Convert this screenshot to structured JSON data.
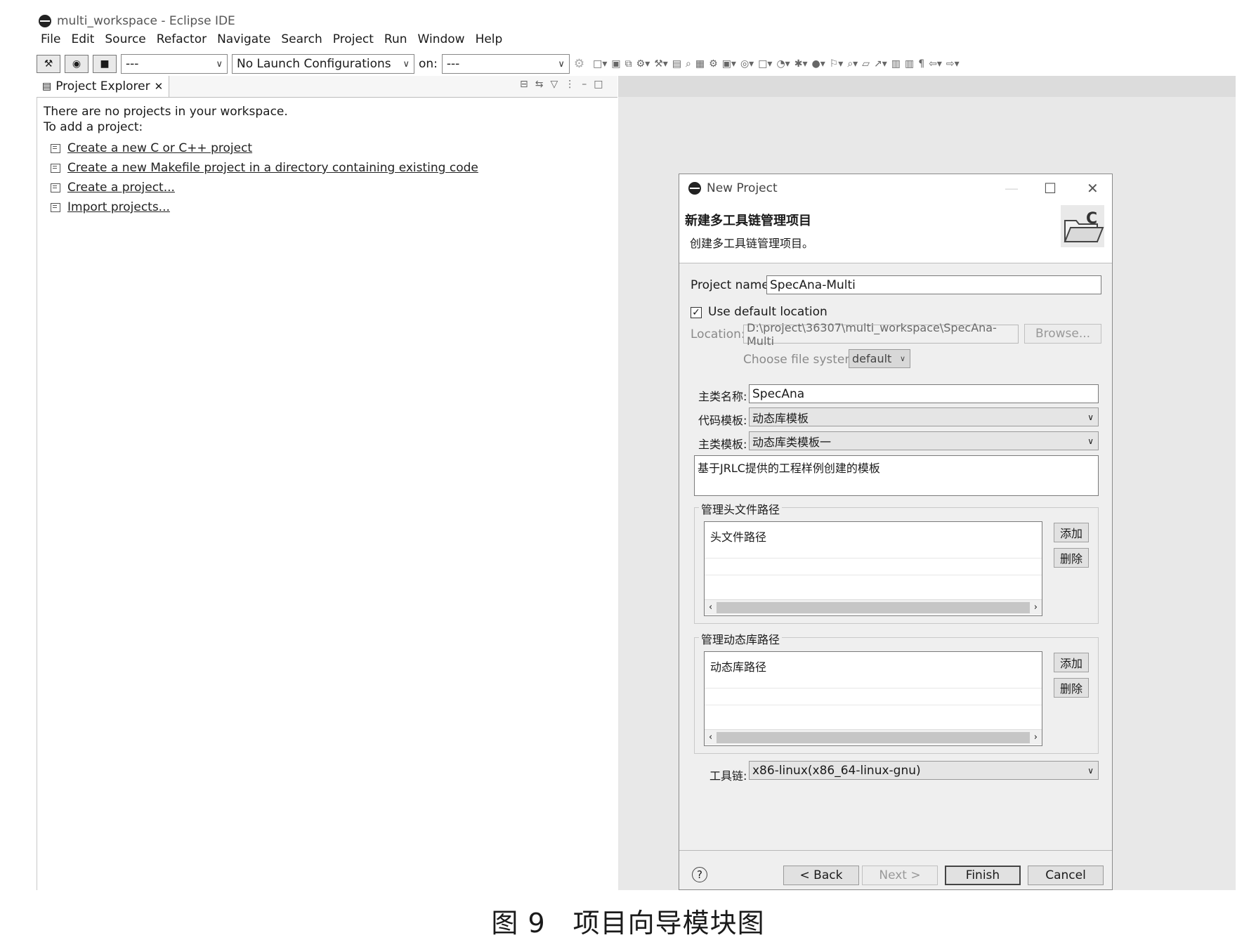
{
  "window": {
    "title": "multi_workspace - Eclipse IDE"
  },
  "menu": [
    "File",
    "Edit",
    "Source",
    "Refactor",
    "Navigate",
    "Search",
    "Project",
    "Run",
    "Window",
    "Help"
  ],
  "toolbar": {
    "build_icon": "hammer-icon",
    "launch_mode_value": "---",
    "launch_config_value": "No Launch Configurations",
    "on_label": "on:",
    "target_value": "---"
  },
  "project_explorer": {
    "tab_label": "Project Explorer",
    "message_line1": "There are no projects in your workspace.",
    "message_line2": "To add a project:",
    "links": [
      "Create a new C or C++ project",
      "Create a new Makefile project in a directory containing existing code",
      "Create a project...",
      "Import projects..."
    ]
  },
  "dialog": {
    "title": "New Project",
    "heading": "新建多工具链管理项目",
    "subheading": "创建多工具链管理项目。",
    "project_name_label": "Project name:",
    "project_name_value": "SpecAna-Multi",
    "use_default_label": "Use default location",
    "use_default_checked": true,
    "location_label": "Location:",
    "location_value": "D:\\project\\36307\\multi_workspace\\SpecAna-Multi",
    "browse_label": "Browse...",
    "file_system_label": "Choose file system:",
    "file_system_value": "default",
    "main_class_label": "主类名称:",
    "main_class_value": "SpecAna",
    "code_template_label": "代码模板:",
    "code_template_value": "动态库模板",
    "class_template_label": "主类模板:",
    "class_template_value": "动态库类模板一",
    "template_description": "基于JRLC提供的工程样例创建的模板",
    "header_group_title": "管理头文件路径",
    "header_list_item": "头文件路径",
    "lib_group_title": "管理动态库路径",
    "lib_list_item": "动态库路径",
    "add_label": "添加",
    "delete_label": "删除",
    "toolchain_label": "工具链:",
    "toolchain_value": "x86-linux(x86_64-linux-gnu)",
    "back_label": "< Back",
    "next_label": "Next >",
    "finish_label": "Finish",
    "cancel_label": "Cancel"
  },
  "caption": "图 9　项目向导模块图"
}
